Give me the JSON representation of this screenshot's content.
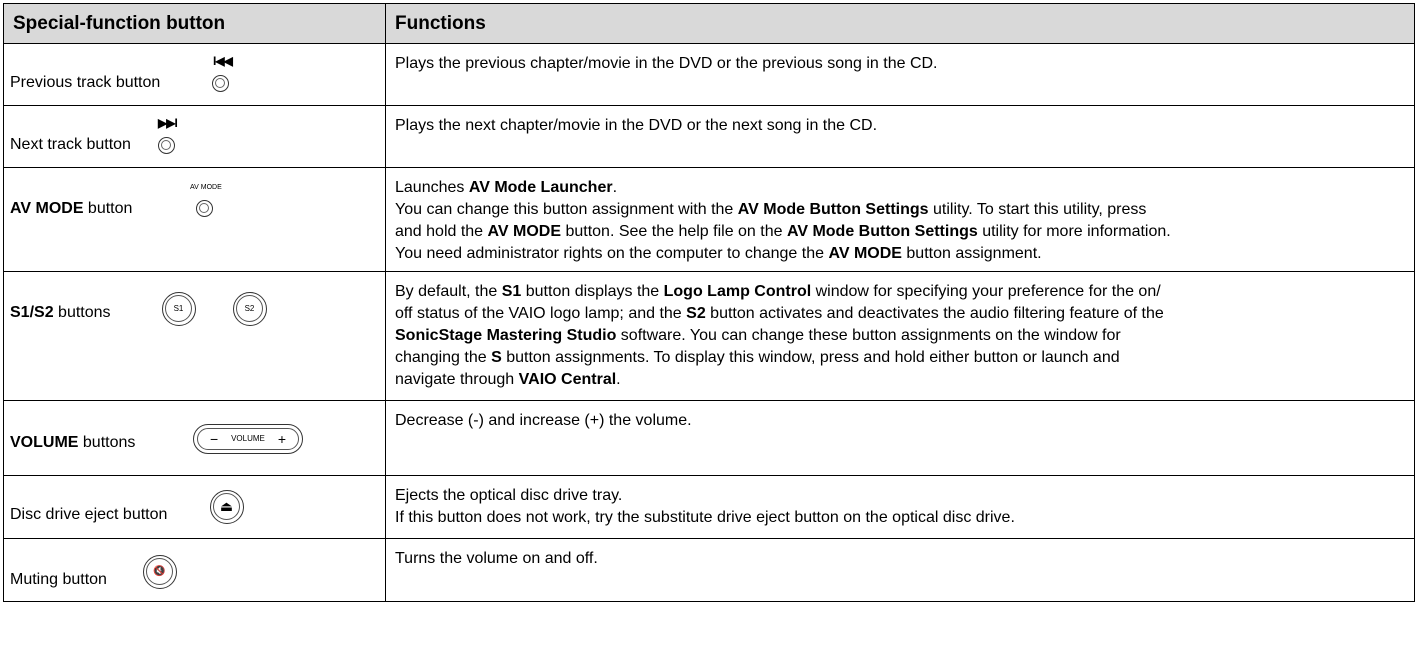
{
  "table": {
    "headers": [
      "Special-function button",
      "Functions"
    ],
    "rows": [
      {
        "label_plain": "Previous track button",
        "icon_caption": "I◀◀",
        "functions": [
          "Plays the previous chapter/movie in the DVD or the previous song in the CD."
        ]
      },
      {
        "label_plain": "Next track button",
        "icon_caption": "▶▶I",
        "functions": [
          "Plays the next chapter/movie in the DVD or the next song in the CD."
        ]
      },
      {
        "label_bold": "AV MODE",
        "label_plain": " button",
        "icon_caption": "AV MODE",
        "functions_html": [
          [
            {
              "t": "Launches "
            },
            {
              "b": "AV Mode Launcher"
            },
            {
              "t": "."
            }
          ],
          [
            {
              "t": "You can change this button assignment with the "
            },
            {
              "b": "AV Mode Button Settings"
            },
            {
              "t": " utility. To start this utility, press"
            }
          ],
          [
            {
              "t": "and hold the "
            },
            {
              "b": "AV MODE"
            },
            {
              "t": " button. See the help file on the "
            },
            {
              "b": "AV Mode Button Settings"
            },
            {
              "t": " utility for more information."
            }
          ],
          [
            {
              "t": "You need administrator rights on the computer to change the "
            },
            {
              "b": "AV MODE"
            },
            {
              "t": " button assignment."
            }
          ]
        ]
      },
      {
        "label_bold": "S1/S2",
        "label_plain": " buttons",
        "btn1": "S1",
        "btn2": "S2",
        "functions_html": [
          [
            {
              "t": "By default, the "
            },
            {
              "b": "S1"
            },
            {
              "t": " button displays the "
            },
            {
              "b": "Logo Lamp Control"
            },
            {
              "t": " window for specifying your preference for the on/"
            }
          ],
          [
            {
              "t": "off status of the VAIO logo lamp; and the "
            },
            {
              "b": "S2"
            },
            {
              "t": " button activates and deactivates the audio filtering feature of the"
            }
          ],
          [
            {
              "b": "SonicStage Mastering Studio"
            },
            {
              "t": " software. You can change these button assignments on the window for"
            }
          ],
          [
            {
              "t": "changing the "
            },
            {
              "b": "S"
            },
            {
              "t": " button assignments. To display this window, press and hold either button or launch and"
            }
          ],
          [
            {
              "t": "navigate through "
            },
            {
              "b": "VAIO Central"
            },
            {
              "t": "."
            }
          ]
        ]
      },
      {
        "label_bold": "VOLUME",
        "label_plain": " buttons",
        "vol_minus": "−",
        "vol_text": "VOLUME",
        "vol_plus": "+",
        "functions": [
          "Decrease (-) and increase (+) the volume."
        ]
      },
      {
        "label_plain": "Disc drive eject button",
        "icon": "eject-icon",
        "icon_glyph": "⏏",
        "functions": [
          "Ejects the optical disc drive tray.",
          "If this button does not work, try the substitute drive eject button on the optical disc drive."
        ]
      },
      {
        "label_plain": "Muting button",
        "icon": "mute-icon",
        "icon_glyph": "🔇",
        "functions": [
          "Turns the volume on and off."
        ]
      }
    ]
  }
}
